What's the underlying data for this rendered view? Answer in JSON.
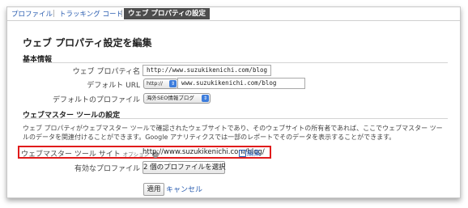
{
  "tabs": [
    {
      "label": "プロファイル"
    },
    {
      "label": "トラッキング コード"
    },
    {
      "label": "ウェブ プロパティの設定"
    }
  ],
  "page_title": "ウェブ プロパティ設定を編集",
  "basic_info": {
    "heading": "基本情報",
    "property_name_label": "ウェブ プロパティ名",
    "property_name_value": "http://www.suzukikenichi.com/blog",
    "default_url_label": "デフォルト URL",
    "protocol_value": "http://",
    "default_url_value": "www.suzukikenichi.com/blog",
    "default_profile_label": "デフォルトのプロファイル",
    "default_profile_value": "海外SEO情報ブログ"
  },
  "webmaster": {
    "heading": "ウェブマスター ツールの設定",
    "description": "ウェブ プロパティがウェブマスター ツールで確認されたウェブサイトであり、そのウェブサイトの所有者であれば、ここでウェブマスター ツールのデータを関連付けることができます。Google アナリティクスでは一部のレポートでそのデータを表示することができます。",
    "site_label": "ウェブマスター ツール サイト",
    "optional_label": "オプション",
    "site_value": "http://www.suzukikenichi.com/blog/",
    "edit_label": "編集",
    "enabled_profiles_label": "有効なプロファイル",
    "select_profiles_button": "2 個のプロファイルを選択"
  },
  "actions": {
    "apply_label": "適用",
    "cancel_label": "キャンセル"
  },
  "colors": {
    "link": "#2a5db0",
    "active_tab_bg": "#4d4d4d",
    "highlight_border": "#e01b1b"
  }
}
